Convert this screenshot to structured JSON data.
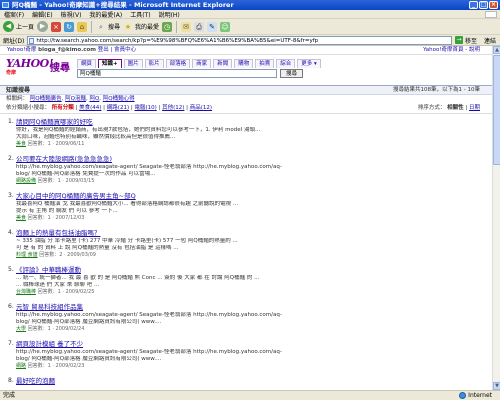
{
  "window": {
    "title": "阿Q桶麵 - Yahoo!奇摩知識+搜尋結果 - Microsoft Internet Explorer",
    "buttons": [
      "_",
      "□",
      "×"
    ]
  },
  "menu": [
    "檔案(F)",
    "編輯(E)",
    "檢視(V)",
    "我的最愛(A)",
    "工具(T)",
    "說明(H)"
  ],
  "toolbar": {
    "back_label": "上一頁",
    "search_label": "搜尋",
    "favorites_label": "我的最愛"
  },
  "address": {
    "label": "網址(D)",
    "url": "http://tw.search.yahoo.com/search/kp?p=%E9%98%BFQ%E6%A1%B6%E9%BA%B5&ei=UTF-8&fr=yfp",
    "go_label": "移至",
    "links_label": "連結"
  },
  "topstrip": {
    "left": "Yahoo!奇摩",
    "user": "bloga_f@kimo.com",
    "links": "登出 | 會員中心",
    "right": "Yahoo!奇摩首頁 - 說明"
  },
  "logo": {
    "brand": "YAHOO!",
    "sub": "奇摩",
    "sou": "搜尋"
  },
  "tabs": [
    "網頁",
    "知識+",
    "圖片",
    "影片",
    "部落格",
    "商家",
    "新聞",
    "購物",
    "拍賣",
    "綜合",
    "更多 ▾"
  ],
  "search": {
    "value": "阿Q桶麵",
    "button_label": "搜尋"
  },
  "knowbar": {
    "title": "知識搜尋",
    "count": "搜尋結果共108筆，以下為1 - 10筆"
  },
  "related": {
    "label": "相關詞：",
    "terms": [
      "阿Q桶麵廣告",
      "阿Q泡麵",
      "阿Q",
      "阿Q桶麵心得"
    ]
  },
  "filter": {
    "label": "依分類縮小搜尋：",
    "all": "所有分類",
    "items": [
      "美食(44)",
      "網路(21)",
      "電腦(10)",
      "其他(12)",
      "商品(12)"
    ],
    "sort_label": "排序方式：",
    "sort_current": "相關性",
    "sort_other": "日期"
  },
  "results": [
    {
      "num": "1.",
      "title": "請問阿Q桶麵買哪家的好吃",
      "snippet": "你好，我是阿Q桶麵的經銷商，有出現7款包括，她們的資料您可以參考一下，1. 伊利 model 湯頭...",
      "snippet2": "大蒜口味，泡麵也特別有鹹味，雖然價錢比較高但是很值得推薦...",
      "category": "美食",
      "meta": "回答數：1 · 2009/06/11"
    },
    {
      "num": "2.",
      "title": "公司要在大陸設網路(急急急急急)",
      "snippet": "http://he.myblog.yahoo.com/seagate-agent/ Seagate-怪老翁部落 http://he.myblog.yahoo.com/aq-",
      "snippet2": "blog/ 阿Q桶麵-阿Q部落格 免費提一次的作品 可以當場...",
      "category": "網路設備",
      "meta": "回答數：1 · 2009/03/15"
    },
    {
      "num": "3.",
      "title": "大家心目中的阿Q桶麵的廣告男主角~部Q",
      "snippet": "我最喜阿Q 桶麵演 戈 我最喜歡阿Q桶麵大小... 看得部落格網誌都很有趣 之前聽說的電視 ...",
      "snippet2": "提示 有 主角 的 網友 們 可以 參考 一下...",
      "category": "美食",
      "meta": "回答數：1 · 2007/12/03"
    },
    {
      "num": "4.",
      "title": "泡麵上的熱量有包括油脂嗎？",
      "snippet": "~ 335 油脂 分 率卡路里 (卡) 277 中華 冷麵 分 卡路里(卡) 577 一包 阿Q桶麵的熱量約 ...",
      "snippet2": "可 是 有 的 資料 上 說 阿Q桶麵的熱量 沒有 包括油脂 是 這樣嗎 ...",
      "category": "料理 食譜",
      "meta": "回答數：2 · 2009/03/09"
    },
    {
      "num": "5.",
      "title": "《評論》中華職棒運動",
      "snippet": "... 統一、統一獅者... 我 最 喜 歡 的 是 阿Q桶麵 熊 Conc ... 簽約 後 大家 都 在 討論 阿Q桶麵 的 ...",
      "snippet2": "... 職棒球迷 們 大家 來 聊聊 吧 ...",
      "category": "台灣職棒",
      "meta": "回答數：1 · 2009/02/25"
    },
    {
      "num": "6.",
      "title": "元智 貿易科技組作品集",
      "snippet": "http://he.myblog.yahoo.com/seagate-agent/ Seagate-怪老翁部落 http://he.myblog.yahoo.com/aq-",
      "snippet2": "blog/ 阿Q桶麵-阿Q部落格 魔豆網路資訊有限公司( www....",
      "category": "大學",
      "meta": "回答數：1 · 2009/02/24"
    },
    {
      "num": "7.",
      "title": "網頁設計模組 養了不少",
      "snippet": "http://he.myblog.yahoo.com/seagate-agent/ Seagate-怪老翁部落 http://he.myblog.yahoo.com/aq-",
      "snippet2": "blog/ 阿Q桶麵-阿Q部落格 魔豆網路資訊有限公司( www....",
      "category": "網路",
      "meta": "回答數：1 · 2009/02/23"
    },
    {
      "num": "8.",
      "title": "最好吃的泡麵",
      "snippet": "",
      "snippet2": "",
      "category": "",
      "meta": ""
    }
  ],
  "status": {
    "left": "完成",
    "zone": "Internet"
  }
}
